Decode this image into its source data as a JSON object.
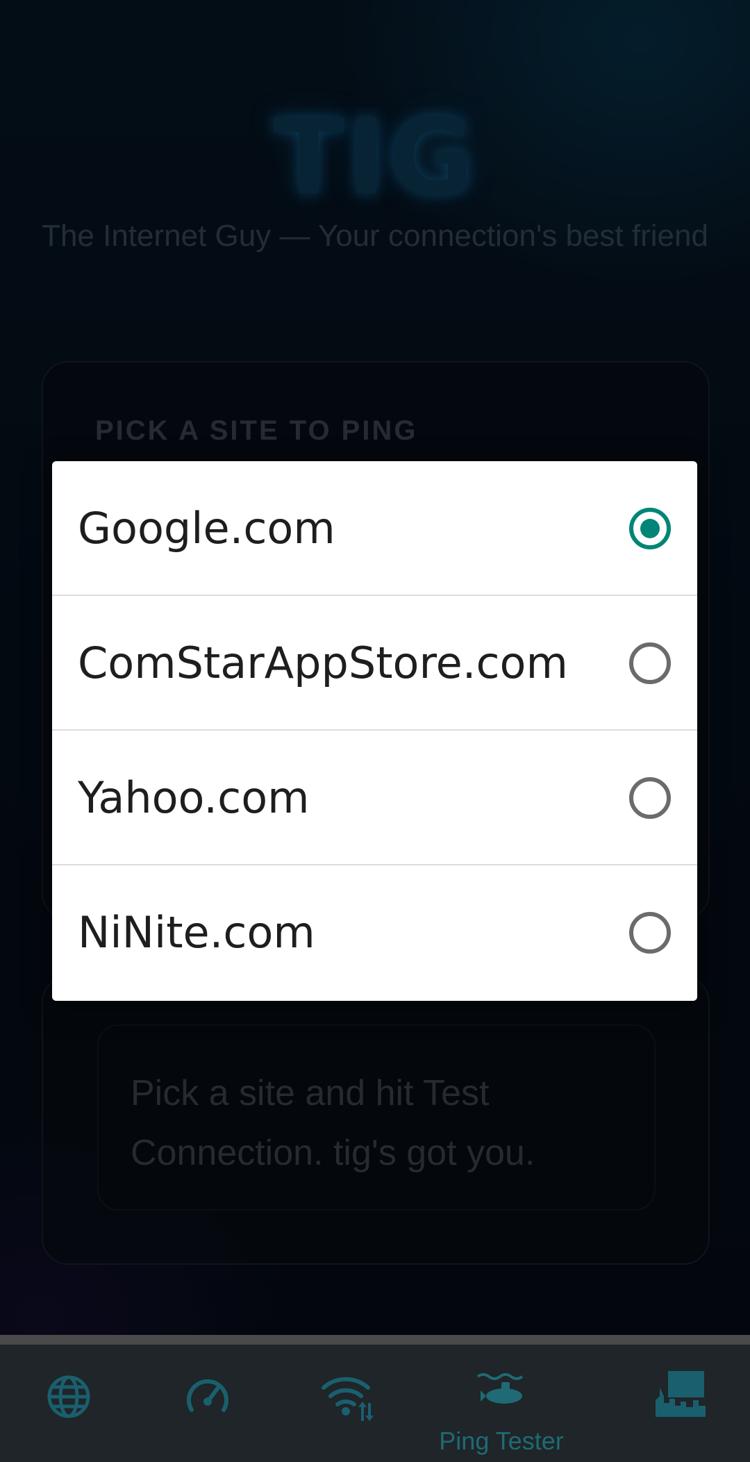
{
  "app": {
    "logo": "TIG",
    "tagline": "The Internet Guy — Your connection's best friend"
  },
  "ping_card": {
    "heading": "PICK A SITE TO PING"
  },
  "result_card": {
    "message": "Pick a site and hit Test Connection. tig's got you."
  },
  "site_dialog": {
    "options": [
      {
        "label": "Google.com",
        "selected": true
      },
      {
        "label": "ComStarAppStore.com",
        "selected": false
      },
      {
        "label": "Yahoo.com",
        "selected": false
      },
      {
        "label": "NiNite.com",
        "selected": false
      }
    ]
  },
  "bottom_nav": {
    "items": [
      {
        "icon": "globe-icon",
        "label": ""
      },
      {
        "icon": "speedometer-icon",
        "label": ""
      },
      {
        "icon": "wifi-transfer-icon",
        "label": ""
      },
      {
        "icon": "submarine-icon",
        "label": "Ping Tester",
        "active": true
      },
      {
        "icon": "city-icon",
        "label": ""
      }
    ]
  },
  "colors": {
    "accent": "#008577",
    "nav_icon": "#1a5f6e",
    "nav_bg": "#1f2528"
  }
}
